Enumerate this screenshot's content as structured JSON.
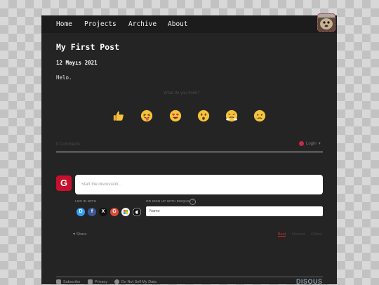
{
  "nav": {
    "items": [
      "Home",
      "Projects",
      "Archive",
      "About"
    ]
  },
  "post": {
    "title": "My First Post",
    "date": "12 Mayıs 2021",
    "body": "Helo."
  },
  "disqus": {
    "reaction_prompt": "What do you think?",
    "reactions": [
      "thumbs-up",
      "tongue-squint",
      "heart-eyes",
      "surprised",
      "steam-nose",
      "sad-tear"
    ],
    "comments_count": "0 Comments",
    "login_label": "Login",
    "comment_placeholder": "Start the discussion...",
    "log_in_with_label": "LOG IN WITH",
    "sign_up_label": "OR SIGN UP WITH DISQUS",
    "help_glyph": "?",
    "social_buttons": [
      {
        "label": "D",
        "color": "#2e9fff"
      },
      {
        "label": "f",
        "color": "#3b5998"
      },
      {
        "label": "X",
        "color": "#111111"
      },
      {
        "label": "G",
        "color": "#dd4b39"
      },
      {
        "label": "",
        "color": "#f2f2f2"
      },
      {
        "label": "",
        "color": "#111111"
      }
    ],
    "name_placeholder": "Name",
    "share_label": "Share",
    "sort_options": [
      "Best",
      "Newest",
      "Oldest"
    ],
    "active_sort": "Best",
    "footer": {
      "subscribe": "Subscribe",
      "privacy": "Privacy",
      "do_not_sell": "Do Not Sell My Data"
    },
    "logo": "DISQUS",
    "avatar_letter": "G"
  },
  "colors": {
    "accent": "#c8102e",
    "background": "#242424",
    "nav": "#1c1c1c"
  }
}
